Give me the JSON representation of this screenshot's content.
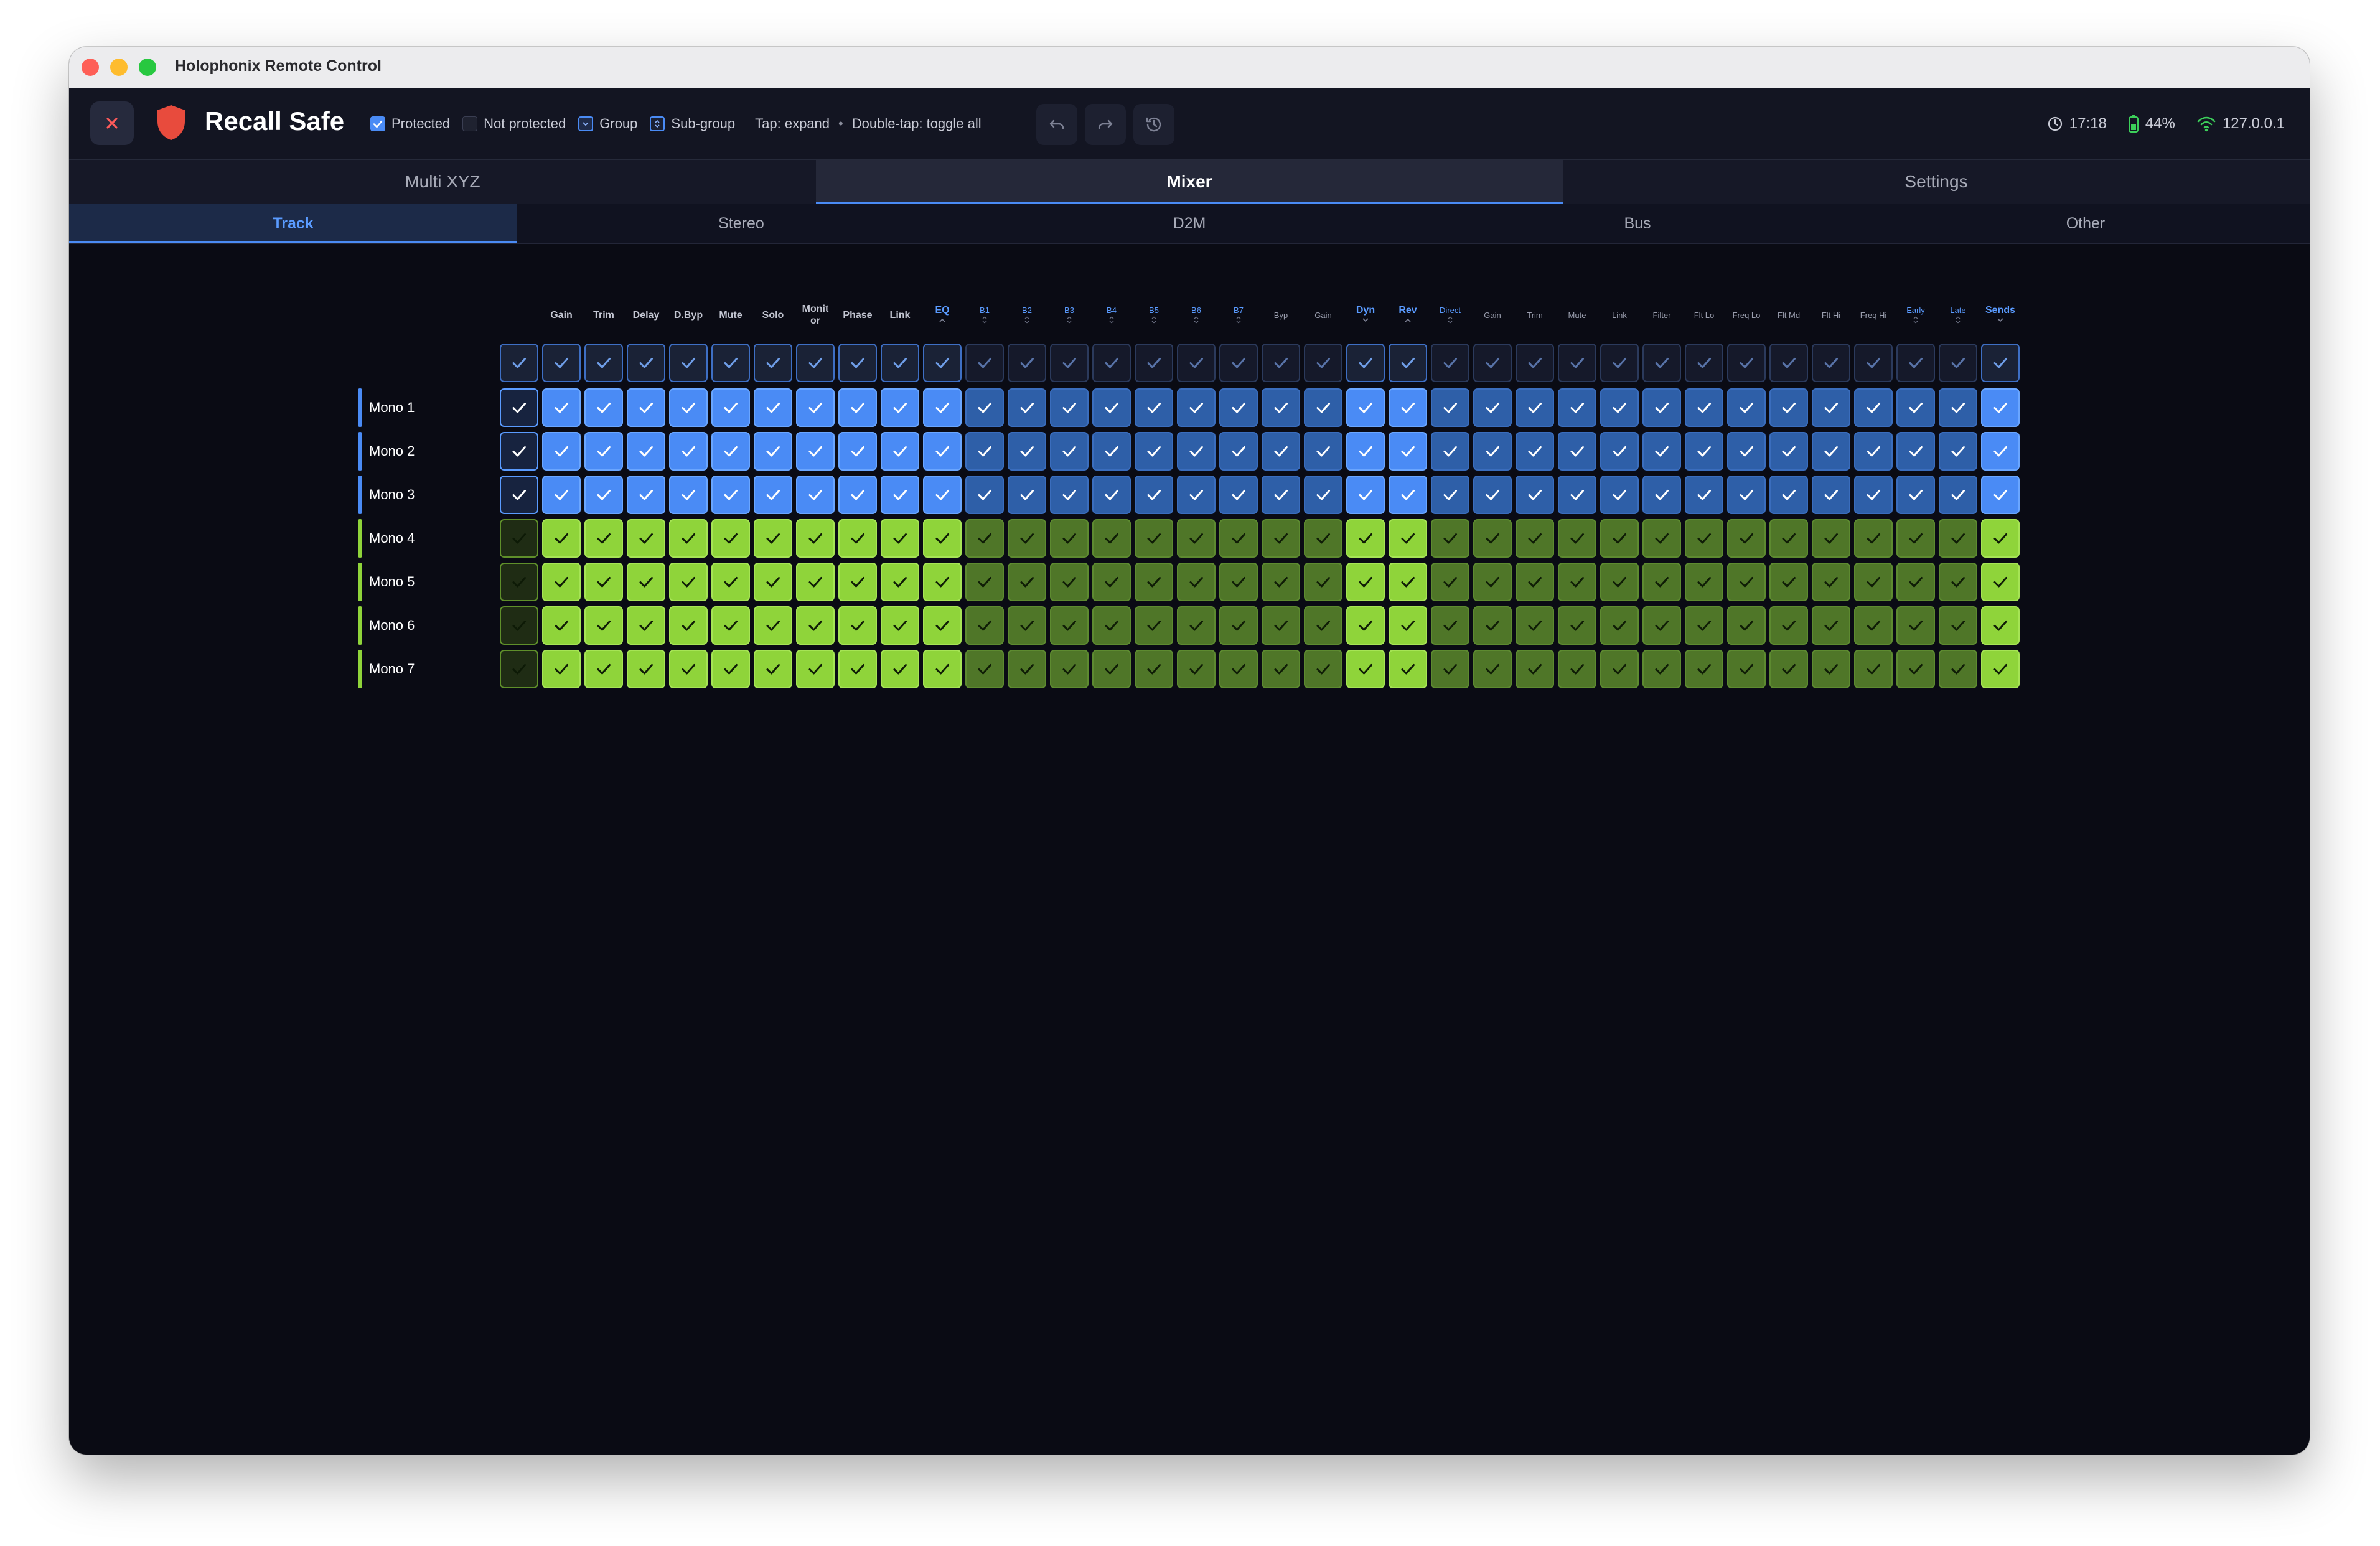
{
  "window": {
    "title": "Holophonix Remote Control"
  },
  "header": {
    "close_icon": "close-icon",
    "title": "Recall Safe",
    "legend": {
      "protected": "Protected",
      "not_protected": "Not protected",
      "group": "Group",
      "subgroup": "Sub-group"
    },
    "hint_tap": "Tap: expand",
    "hint_sep": "•",
    "hint_double": "Double-tap: toggle all",
    "history_buttons": [
      "undo-icon",
      "redo-icon",
      "history-icon"
    ],
    "time": "17:18",
    "battery": "44%",
    "ip": "127.0.0.1"
  },
  "tabs": [
    "Multi XYZ",
    "Mixer",
    "Settings"
  ],
  "active_tab": "Mixer",
  "subtabs": [
    "Track",
    "Stereo",
    "D2M",
    "Bus",
    "Other"
  ],
  "active_subtab": "Track",
  "columns": [
    {
      "label": "",
      "style": "name"
    },
    {
      "label": "Gain",
      "style": "normal"
    },
    {
      "label": "Trim",
      "style": "normal"
    },
    {
      "label": "Delay",
      "style": "normal"
    },
    {
      "label": "D.Byp",
      "style": "normal"
    },
    {
      "label": "Mute",
      "style": "normal"
    },
    {
      "label": "Solo",
      "style": "normal"
    },
    {
      "label": "Monit or",
      "style": "normal"
    },
    {
      "label": "Phase",
      "style": "normal"
    },
    {
      "label": "Link",
      "style": "normal"
    },
    {
      "label": "EQ",
      "style": "group-open"
    },
    {
      "label": "B1",
      "style": "sub"
    },
    {
      "label": "B2",
      "style": "sub"
    },
    {
      "label": "B3",
      "style": "sub"
    },
    {
      "label": "B4",
      "style": "sub"
    },
    {
      "label": "B5",
      "style": "sub"
    },
    {
      "label": "B6",
      "style": "sub"
    },
    {
      "label": "B7",
      "style": "sub"
    },
    {
      "label": "Byp",
      "style": "small"
    },
    {
      "label": "Gain",
      "style": "small"
    },
    {
      "label": "Dyn",
      "style": "group-closed"
    },
    {
      "label": "Rev",
      "style": "group-open"
    },
    {
      "label": "Direct",
      "style": "sub"
    },
    {
      "label": "Gain",
      "style": "small"
    },
    {
      "label": "Trim",
      "style": "small"
    },
    {
      "label": "Mute",
      "style": "small"
    },
    {
      "label": "Link",
      "style": "small"
    },
    {
      "label": "Filter",
      "style": "small"
    },
    {
      "label": "Flt Lo",
      "style": "small"
    },
    {
      "label": "Freq Lo",
      "style": "small"
    },
    {
      "label": "Flt Md",
      "style": "small"
    },
    {
      "label": "Flt Hi",
      "style": "small"
    },
    {
      "label": "Freq Hi",
      "style": "small"
    },
    {
      "label": "Early",
      "style": "sub"
    },
    {
      "label": "Late",
      "style": "sub"
    },
    {
      "label": "Sends",
      "style": "group-closed"
    }
  ],
  "rows": [
    {
      "name": "Mono 1",
      "color": "blue",
      "protected": true
    },
    {
      "name": "Mono 2",
      "color": "blue",
      "protected": true
    },
    {
      "name": "Mono 3",
      "color": "blue",
      "protected": true
    },
    {
      "name": "Mono 4",
      "color": "green",
      "protected": true
    },
    {
      "name": "Mono 5",
      "color": "green",
      "protected": true
    },
    {
      "name": "Mono 6",
      "color": "green",
      "protected": true
    },
    {
      "name": "Mono 7",
      "color": "green",
      "protected": true
    }
  ],
  "colors": {
    "accent": "#4a8bf5",
    "blue_cell": "#4a8bf5",
    "blue_cell_sub": "#2e5fa8",
    "green_cell": "#8fd43a",
    "green_cell_sub": "#4f7628",
    "track_blue": "#4a8bf5",
    "track_green": "#8fd43a"
  }
}
